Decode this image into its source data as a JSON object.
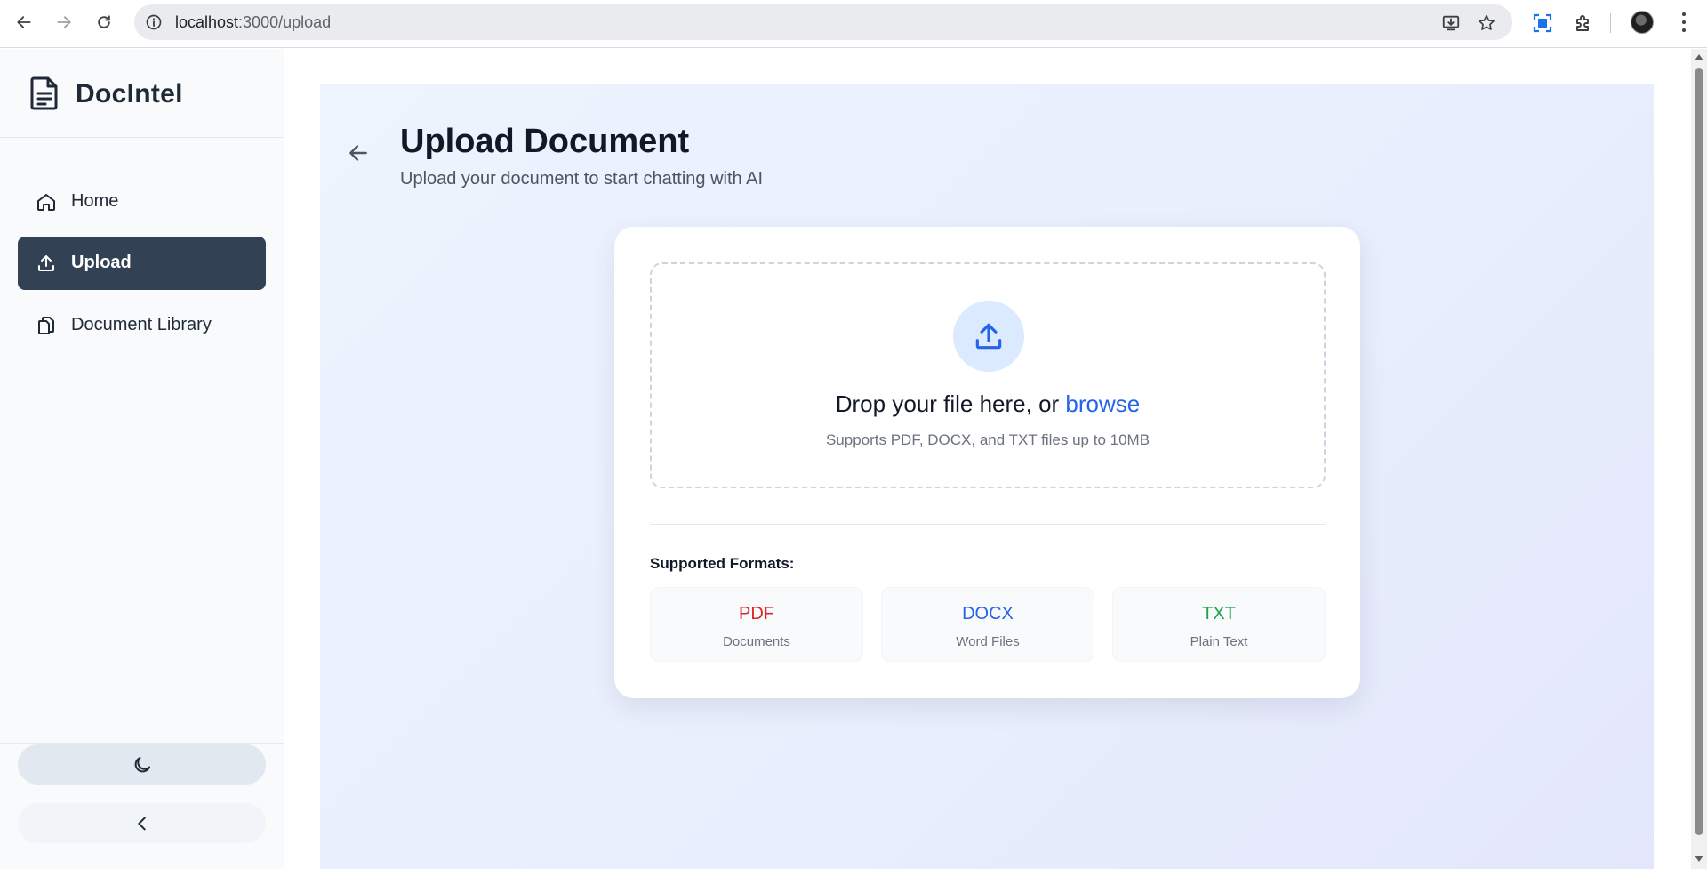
{
  "browser": {
    "url_host": "localhost",
    "url_path": ":3000/upload"
  },
  "sidebar": {
    "brand": "DocIntel",
    "items": [
      {
        "label": "Home",
        "icon": "home-icon",
        "active": false
      },
      {
        "label": "Upload",
        "icon": "upload-icon",
        "active": true
      },
      {
        "label": "Document Library",
        "icon": "documents-icon",
        "active": false
      }
    ],
    "theme_toggle_icon": "moon-icon",
    "collapse_icon": "chevron-left-icon"
  },
  "main": {
    "title": "Upload Document",
    "subtitle": "Upload your document to start chatting with AI",
    "dropzone": {
      "text_prefix": "Drop your file here, or ",
      "browse_label": "browse",
      "hint": "Supports PDF, DOCX, and TXT files up to 10MB"
    },
    "formats_label": "Supported Formats:",
    "formats": [
      {
        "name": "PDF",
        "desc": "Documents",
        "color": "#dc2626"
      },
      {
        "name": "DOCX",
        "desc": "Word Files",
        "color": "#2563eb"
      },
      {
        "name": "TXT",
        "desc": "Plain Text",
        "color": "#16a34a"
      }
    ]
  },
  "colors": {
    "accent": "#2563eb",
    "active_nav": "#334155"
  }
}
